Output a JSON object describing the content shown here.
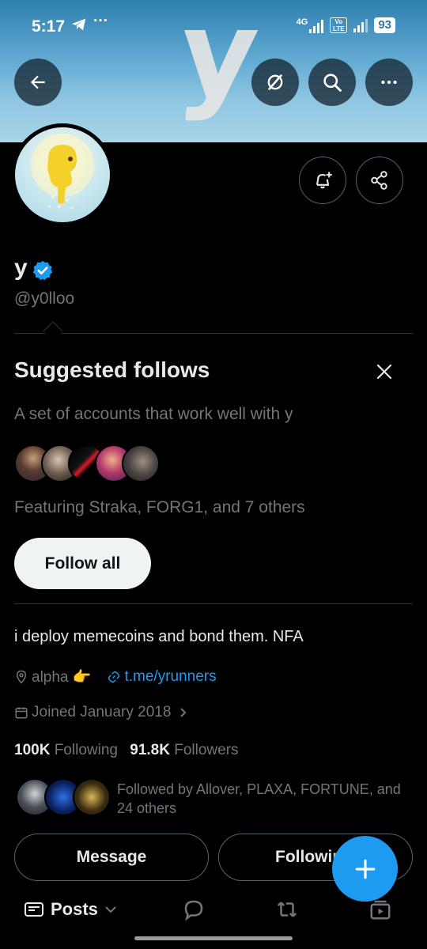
{
  "status_bar": {
    "time": "5:17",
    "more": "···",
    "network": "4G",
    "volte": "Vo LTE",
    "battery": "93"
  },
  "banner": {
    "letter": "y"
  },
  "top_actions": [
    "back-arrow-icon",
    "grok-icon",
    "search-icon",
    "more-icon"
  ],
  "profile": {
    "display_name": "y",
    "handle": "@y0lloo",
    "bio": "i deploy memecoins and bond them. NFA",
    "location": "alpha 👉",
    "link": "t.me/yrunners",
    "joined": "Joined January 2018",
    "following_count": "100K",
    "following_label": "Following",
    "followers_count": "91.8K",
    "followers_label": "Followers",
    "followed_by": "Followed by Allover, PLAXA, FORTUNE, and 24 others"
  },
  "suggested": {
    "title": "Suggested follows",
    "description": "A set of accounts that work well with y",
    "featuring": "Featuring Straka, FORG1, and 7 others",
    "follow_all": "Follow all"
  },
  "buttons": {
    "message": "Message",
    "following": "Following"
  },
  "tabs": {
    "posts": "Posts"
  },
  "colors": {
    "accent": "#1d9bf0",
    "background": "#000000",
    "muted": "#71767b",
    "text": "#e7e9ea"
  }
}
